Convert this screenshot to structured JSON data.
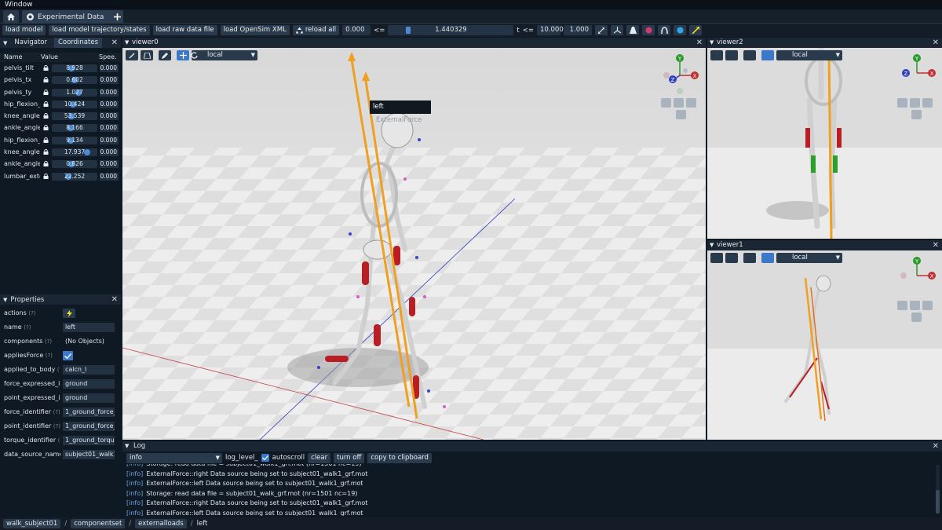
{
  "window_title": "Window",
  "tabs": {
    "active": "Experimental Data"
  },
  "toolbar": {
    "load_model": "load model",
    "load_traj": "load model trajectory/states",
    "load_raw": "load raw data file",
    "load_xml": "load OpenSim XML",
    "reload": "reload all",
    "t_start": "0.000",
    "lte1": "<=",
    "t_current": "1.440329",
    "t_label": "t",
    "lte2": "<=",
    "t_end": "10.000",
    "speed": "1.000"
  },
  "navigator": {
    "title": "Navigator",
    "coords_tab": "Coordinates",
    "col_name": "Name",
    "col_value": "Value",
    "col_speed": "Spee.",
    "rows": [
      {
        "name": "pelvis_tilt",
        "value": "8.928",
        "speed": "0.000",
        "pos": 0.42
      },
      {
        "name": "pelvis_tx",
        "value": "0.602",
        "speed": "0.000",
        "pos": 0.5
      },
      {
        "name": "pelvis_ty",
        "value": "1.027",
        "speed": "0.000",
        "pos": 0.6
      },
      {
        "name": "hip_flexion_",
        "value": "10.424",
        "speed": "0.000",
        "pos": 0.45
      },
      {
        "name": "knee_angle_",
        "value": "53.539",
        "speed": "0.000",
        "pos": 0.42
      },
      {
        "name": "ankle_angle",
        "value": "8.166",
        "speed": "0.000",
        "pos": 0.4
      },
      {
        "name": "hip_flexion_",
        "value": "9.134",
        "speed": "0.000",
        "pos": 0.4
      },
      {
        "name": "knee_angle_",
        "value": "17.937",
        "speed": "0.000",
        "pos": 0.82
      },
      {
        "name": "ankle_angle",
        "value": "0.826",
        "speed": "0.000",
        "pos": 0.42
      },
      {
        "name": "lumbar_exte",
        "value": "22.252",
        "speed": "0.000",
        "pos": 0.33
      }
    ]
  },
  "properties": {
    "title": "Properties",
    "q": "(?)",
    "rows": [
      {
        "name": "actions",
        "value": "",
        "kind": "button"
      },
      {
        "name": "name",
        "value": "left",
        "kind": "field"
      },
      {
        "name": "components",
        "value": "(No Objects)",
        "kind": "plain"
      },
      {
        "name": "appliesForce",
        "value": "",
        "kind": "check"
      },
      {
        "name": "applied_to_body",
        "value": "calcn_l",
        "kind": "field"
      },
      {
        "name": "force_expressed_in",
        "value": "ground",
        "kind": "field"
      },
      {
        "name": "point_expressed_in",
        "value": "ground",
        "kind": "field"
      },
      {
        "name": "force_identifier",
        "value": "1_ground_force_",
        "kind": "field"
      },
      {
        "name": "point_identifier",
        "value": "1_ground_force_",
        "kind": "field"
      },
      {
        "name": "torque_identifier",
        "value": "1_ground_torque",
        "kind": "field"
      },
      {
        "name": "data_source_name",
        "value": "subject01_walk1_",
        "kind": "field"
      }
    ]
  },
  "viewers": {
    "v0": "viewer0",
    "v1": "viewer1",
    "v2": "viewer2",
    "frame_mode": "local"
  },
  "tooltip": {
    "name": "left",
    "type": "ExternalForce"
  },
  "gizmo": {
    "x": "X",
    "y": "Y",
    "z": "Z"
  },
  "log": {
    "title": "Log",
    "level": "info",
    "level_label": "log_level_",
    "autoscroll": "autoscroll",
    "clear": "clear",
    "turn_off": "turn off",
    "copy": "copy to clipboard",
    "lines": [
      {
        "lvl": "[info]",
        "msg": "Storage: read data file = subject01_walk1_grf.mot (nr=1501 nc=19)"
      },
      {
        "lvl": "[info]",
        "msg": "ExternalForce::right Data source being set to subject01_walk1_grf.mot"
      },
      {
        "lvl": "[info]",
        "msg": "ExternalForce::left Data source being set to subject01_walk1_grf.mot"
      },
      {
        "lvl": "[info]",
        "msg": "Storage: read data file = subject01_walk_grf.mot (nr=1501 nc=19)"
      },
      {
        "lvl": "[info]",
        "msg": "ExternalForce::right Data source being set to subject01_walk1_grf.mot"
      },
      {
        "lvl": "[info]",
        "msg": "ExternalForce::left Data source being set to subject01_walk1_grf.mot"
      }
    ]
  },
  "breadcrumb": [
    "walk_subject01",
    "componentset",
    "externalloads",
    "left"
  ],
  "colors": {
    "accent": "#3c78c8",
    "muscle": "#c0272d",
    "force": "#f0a020"
  }
}
